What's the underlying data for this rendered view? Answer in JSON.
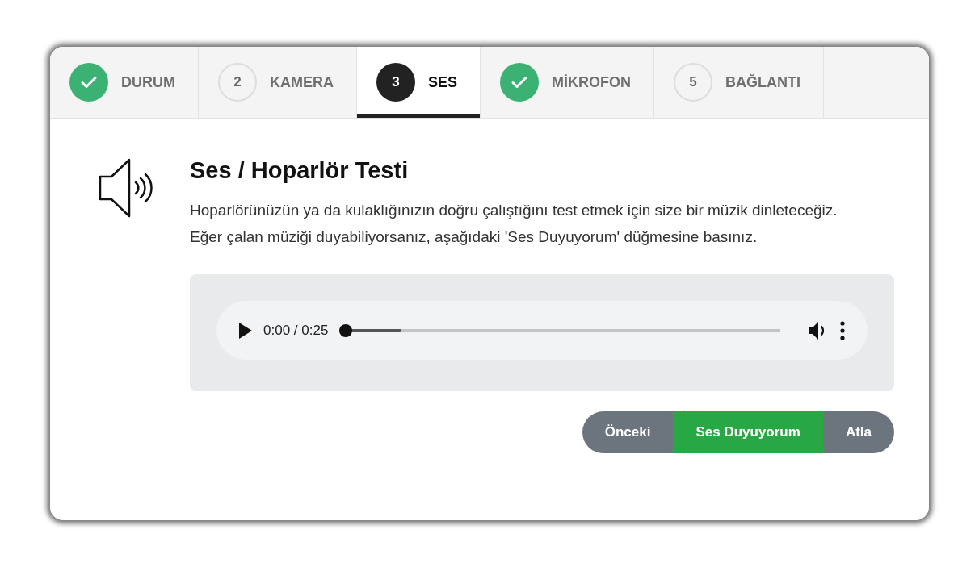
{
  "steps": [
    {
      "kind": "done",
      "label": "DURUM",
      "selected": false
    },
    {
      "kind": "number",
      "number": "2",
      "label": "KAMERA",
      "selected": false
    },
    {
      "kind": "number",
      "number": "3",
      "label": "SES",
      "selected": true
    },
    {
      "kind": "done",
      "label": "MİKROFON",
      "selected": false
    },
    {
      "kind": "number",
      "number": "5",
      "label": "BAĞLANTI",
      "selected": false
    }
  ],
  "title": "Ses / Hoparlör Testi",
  "description": "Hoparlörünüzün ya da kulaklığınızın doğru çalıştığını test etmek için size bir müzik dinleteceğiz. Eğer çalan müziği duyabiliyorsanız, aşağıdaki 'Ses Duyuyorum' düğmesine basınız.",
  "player": {
    "time": "0:00 / 0:25",
    "level": 0.14
  },
  "buttons": [
    {
      "label": "Önceki",
      "kind": "secondary"
    },
    {
      "label": "Ses Duyuyorum",
      "kind": "primary"
    },
    {
      "label": "Atla",
      "kind": "secondary"
    }
  ]
}
